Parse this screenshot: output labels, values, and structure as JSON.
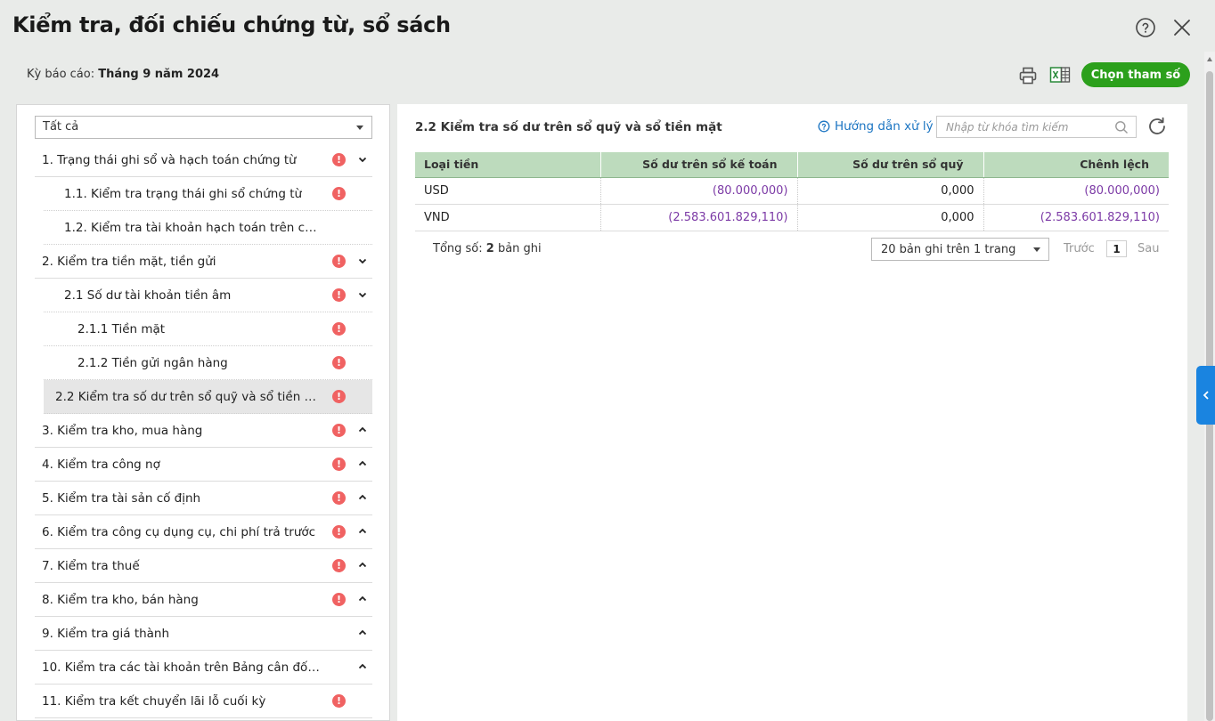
{
  "header": {
    "title": "Kiểm tra, đối chiếu chứng từ, sổ sách",
    "period_label": "Kỳ báo cáo:",
    "period_value": "Tháng 9 năm 2024",
    "choose_params_label": "Chọn tham số"
  },
  "filter": {
    "selected": "Tất cả"
  },
  "tree": [
    {
      "label": "1. Trạng thái ghi sổ và hạch toán chứng từ",
      "warn": true,
      "chevron": "down"
    },
    {
      "label": "1.1. Kiểm tra trạng thái ghi sổ chứng từ",
      "warn": true,
      "chevron": ""
    },
    {
      "label": "1.2. Kiểm tra tài khoản hạch toán trên chứng từ",
      "warn": false,
      "chevron": ""
    },
    {
      "label": "2. Kiểm tra tiền mặt, tiền gửi",
      "warn": true,
      "chevron": "down"
    },
    {
      "label": "2.1 Số dư tài khoản tiền âm",
      "warn": true,
      "chevron": "down"
    },
    {
      "label": "2.1.1 Tiền mặt",
      "warn": true,
      "chevron": ""
    },
    {
      "label": "2.1.2 Tiền gửi ngân hàng",
      "warn": true,
      "chevron": ""
    },
    {
      "label": "2.2 Kiểm tra số dư trên sổ quỹ và sổ tiền mặt",
      "warn": true,
      "chevron": ""
    },
    {
      "label": "3. Kiểm tra kho, mua hàng",
      "warn": true,
      "chevron": "up"
    },
    {
      "label": "4. Kiểm tra công nợ",
      "warn": true,
      "chevron": "up"
    },
    {
      "label": "5. Kiểm tra tài sản cố định",
      "warn": true,
      "chevron": "up"
    },
    {
      "label": "6. Kiểm tra công cụ dụng cụ, chi phí trả trước",
      "warn": true,
      "chevron": "up"
    },
    {
      "label": "7. Kiểm tra thuế",
      "warn": true,
      "chevron": "up"
    },
    {
      "label": "8. Kiểm tra kho, bán hàng",
      "warn": true,
      "chevron": "up"
    },
    {
      "label": "9. Kiểm tra giá thành",
      "warn": false,
      "chevron": "up"
    },
    {
      "label": "10. Kiểm tra các tài khoản trên Bảng cân đối phát si...",
      "warn": false,
      "chevron": "up"
    },
    {
      "label": "11. Kiểm tra kết chuyển lãi lỗ cuối kỳ",
      "warn": true,
      "chevron": ""
    }
  ],
  "detail": {
    "title": "2.2 Kiểm tra số dư trên sổ quỹ và sổ tiền mặt",
    "guide_label": "Hướng dẫn xử lý",
    "search_placeholder": "Nhập từ khóa tìm kiếm",
    "columns": [
      "Loại tiền",
      "Số dư trên sổ kế toán",
      "Số dư trên sổ quỹ",
      "Chênh lệch"
    ],
    "rows": [
      [
        "USD",
        "(80.000,000)",
        "0,000",
        "(80.000,000)"
      ],
      [
        "VND",
        "(2.583.601.829,110)",
        "0,000",
        "(2.583.601.829,110)"
      ]
    ],
    "total_label": "Tổng số:",
    "total_count": "2",
    "total_unit": "bản ghi",
    "page_size": "20 bản ghi trên 1 trang",
    "prev_label": "Trước",
    "page_number": "1",
    "next_label": "Sau"
  },
  "colors": {
    "accent": "#2ca01c",
    "header_green": "#bddbbd",
    "link": "#1a74c2",
    "warn": "#f06262",
    "negative": "#7c3aa6"
  }
}
